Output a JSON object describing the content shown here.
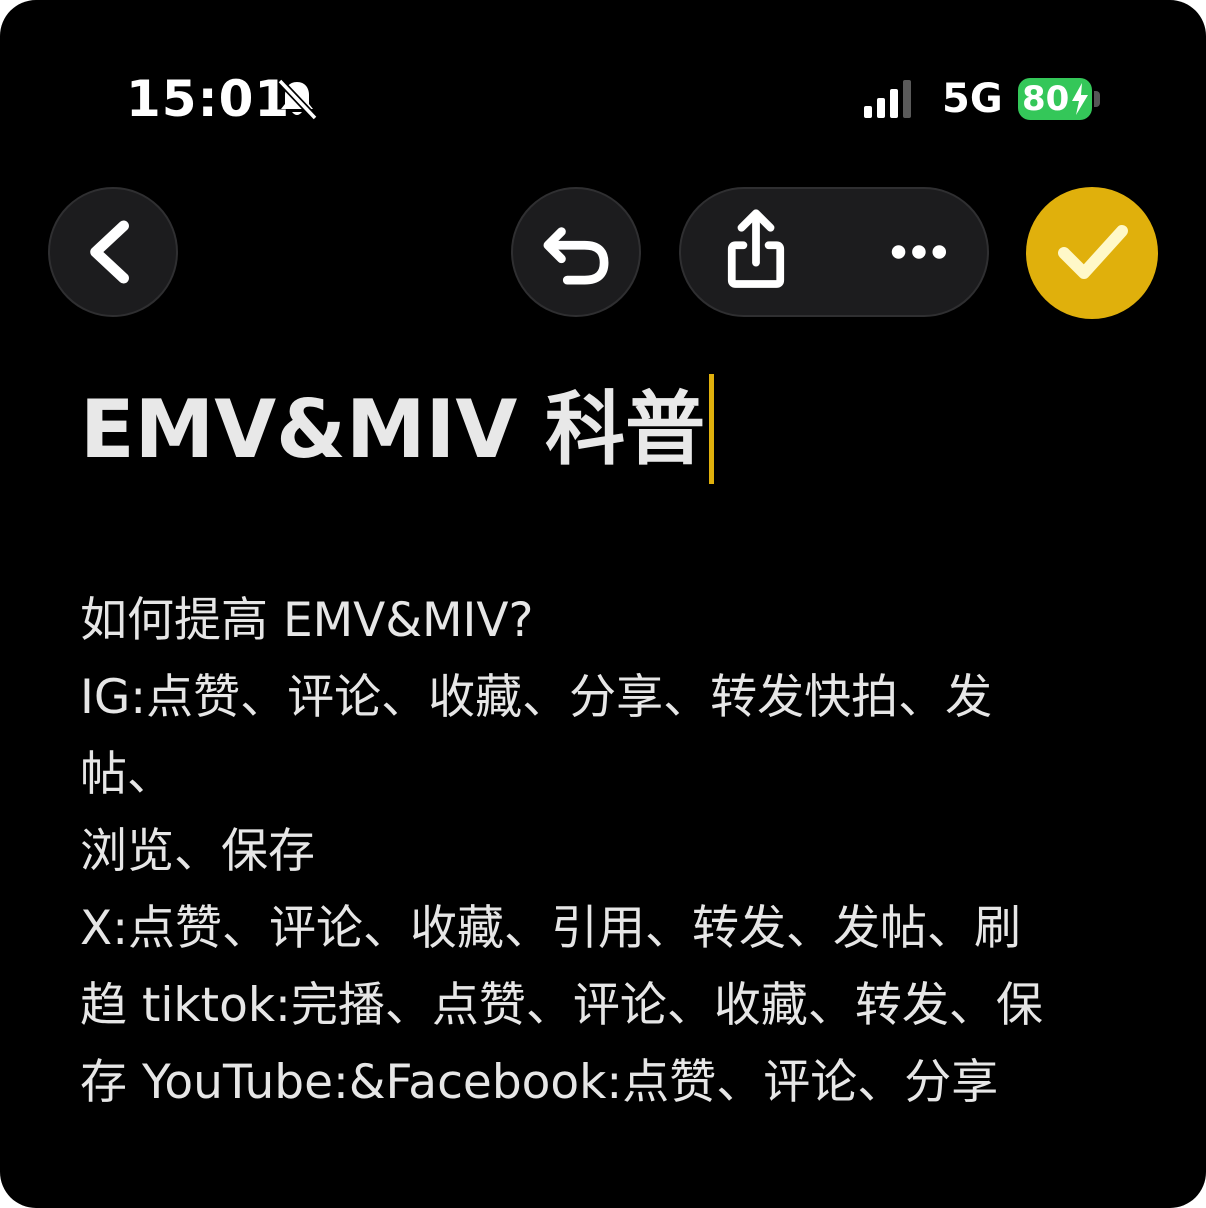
{
  "status_bar": {
    "time": "15:01",
    "network": "5G",
    "battery": "80",
    "icons": [
      "bell-slash-icon",
      "signal-bars-icon",
      "charging-bolt-icon"
    ]
  },
  "toolbar": {
    "icons": [
      "chevron-left-icon",
      "undo-icon",
      "share-icon",
      "more-icon",
      "checkmark-icon"
    ],
    "accent_color": "#e0b00c"
  },
  "note": {
    "title": "EMV&MIV 科普",
    "lines": [
      "如何提高 EMV&MIV?",
      "IG:点赞、评论、收藏、分享、转发快拍、发",
      "帖、",
      "浏览、保存",
      "X:点赞、评论、收藏、引用、转发、发帖、刷",
      "趋 tiktok:完播、点赞、评论、收藏、转发、保",
      "存 YouTube:&Facebook:点赞、评论、分享"
    ]
  }
}
